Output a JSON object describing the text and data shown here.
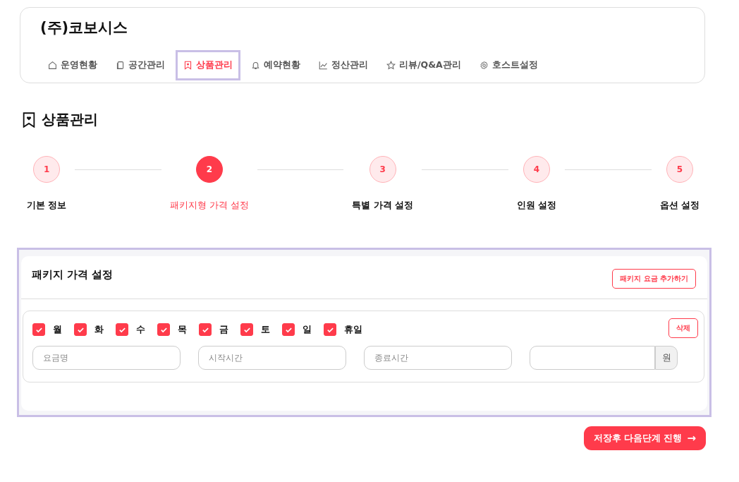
{
  "header": {
    "company": "(주)코보시스",
    "nav": [
      {
        "label": "운영현황",
        "selected": false
      },
      {
        "label": "공간관리",
        "selected": false
      },
      {
        "label": "상품관리",
        "selected": true
      },
      {
        "label": "예약현황",
        "selected": false
      },
      {
        "label": "정산관리",
        "selected": false
      },
      {
        "label": "리뷰/Q&A관리",
        "selected": false
      },
      {
        "label": "호스트설정",
        "selected": false
      }
    ]
  },
  "page_title": "상품관리",
  "steps": [
    {
      "number": "1",
      "label": "기본 정보",
      "selected": false
    },
    {
      "number": "2",
      "label": "패키지형 가격 설정",
      "selected": true
    },
    {
      "number": "3",
      "label": "특별 가격 설정",
      "selected": false
    },
    {
      "number": "4",
      "label": "인원 설정",
      "selected": false
    },
    {
      "number": "5",
      "label": "옵션 설정",
      "selected": false
    }
  ],
  "panel": {
    "title": "패키지 가격 설정",
    "add_button": "패키지 요금 추가하기",
    "rate": {
      "days": [
        {
          "label": "월",
          "checked": true
        },
        {
          "label": "화",
          "checked": true
        },
        {
          "label": "수",
          "checked": true
        },
        {
          "label": "목",
          "checked": true
        },
        {
          "label": "금",
          "checked": true
        },
        {
          "label": "토",
          "checked": true
        },
        {
          "label": "일",
          "checked": true
        },
        {
          "label": "휴일",
          "checked": true
        }
      ],
      "delete_button": "삭제",
      "fields": [
        {
          "placeholder": "요금명"
        },
        {
          "placeholder": "시작시간"
        },
        {
          "placeholder": "종료시간"
        },
        {
          "unit": "원"
        }
      ]
    }
  },
  "save_button": {
    "label": "저장후 다음단계 진행",
    "arrow": "→"
  }
}
